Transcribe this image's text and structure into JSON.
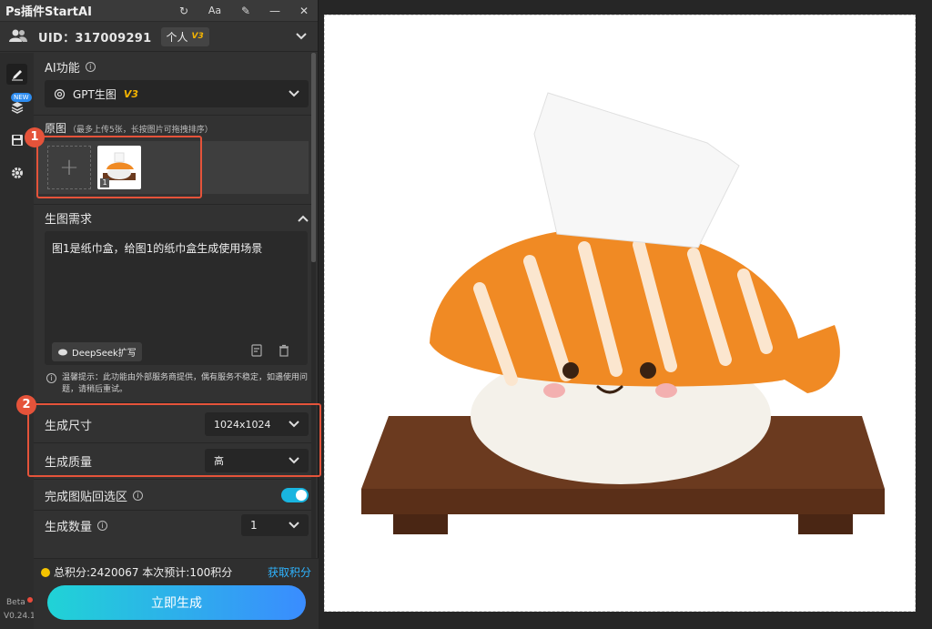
{
  "app": {
    "title": "Ps插件StartAI"
  },
  "titlebar_tools": [
    "refresh-icon",
    "font-size-icon",
    "pin-icon",
    "minimize-icon",
    "close-icon"
  ],
  "font_tool_label": "Aa",
  "user": {
    "uid_label": "UID：317009291",
    "plan": "个人",
    "plan_version": "V3"
  },
  "sidebar": {
    "new_badge": "NEW",
    "beta": "Beta",
    "version": "V0.24.1"
  },
  "ai_function": {
    "label": "AI功能",
    "model": "GPT生图",
    "model_version": "V3"
  },
  "source_image": {
    "label": "原图",
    "hint": "（最多上传5张，长按图片可拖拽排序）",
    "add_symbol": "+",
    "thumb_index": "1"
  },
  "prompt": {
    "label": "生图需求",
    "text": "图1是纸巾盒，给图1的纸巾盒生成使用场景",
    "deepseek": "DeepSeek扩写"
  },
  "tip": "温馨提示：此功能由外部服务商提供，偶有服务不稳定，如遇使用问题，请稍后重试。",
  "settings": {
    "size_label": "生成尺寸",
    "size_value": "1024x1024",
    "quality_label": "生成质量",
    "quality_value": "高",
    "paste_back_label": "完成图贴回选区",
    "paste_back_on": true,
    "count_label": "生成数量",
    "count_value": "1"
  },
  "footer": {
    "points": "总积分:2420067  本次预计:100积分",
    "get_points": "获取积分",
    "generate": "立即生成"
  },
  "annotations": [
    "1",
    "2"
  ],
  "colors": {
    "accent": "#19b5e0",
    "annotation": "#e5533a",
    "coin": "#f5c400",
    "link": "#2fb4ff"
  }
}
